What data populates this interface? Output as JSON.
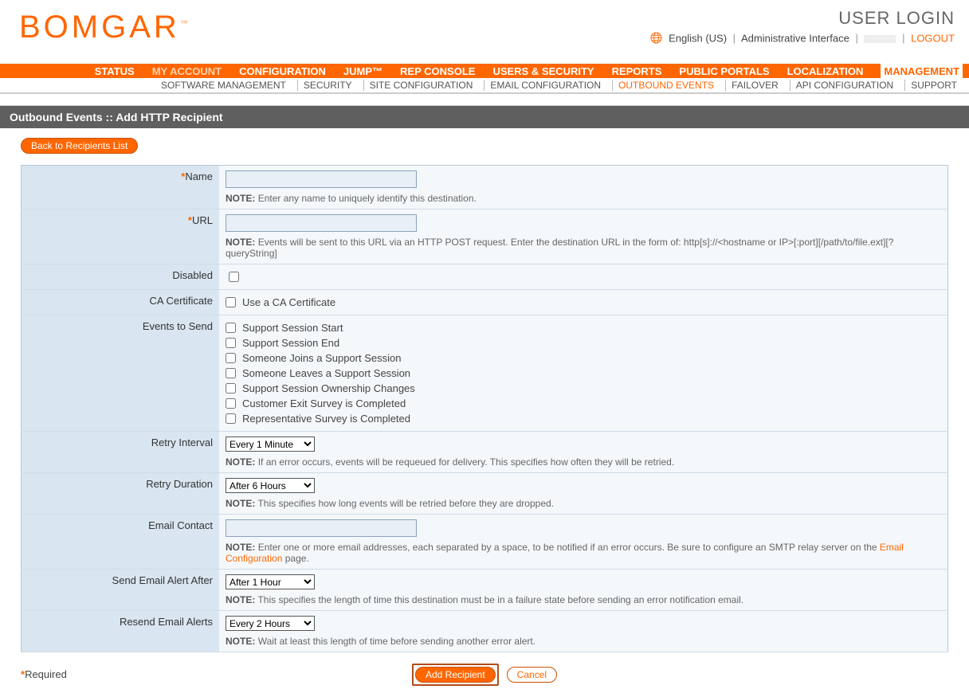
{
  "header": {
    "logo": "BOMGAR",
    "tm": "™",
    "user_login": "USER LOGIN",
    "language": "English (US)",
    "admin_link": "Administrative Interface",
    "logout": "LOGOUT"
  },
  "topnav": [
    {
      "label": "STATUS",
      "style": "normal"
    },
    {
      "label": "MY ACCOUNT",
      "style": "dim"
    },
    {
      "label": "CONFIGURATION",
      "style": "normal"
    },
    {
      "label": "JUMP™",
      "style": "normal"
    },
    {
      "label": "REP CONSOLE",
      "style": "normal"
    },
    {
      "label": "USERS & SECURITY",
      "style": "normal"
    },
    {
      "label": "REPORTS",
      "style": "normal"
    },
    {
      "label": "PUBLIC PORTALS",
      "style": "normal"
    },
    {
      "label": "LOCALIZATION",
      "style": "normal"
    },
    {
      "label": "MANAGEMENT",
      "style": "inv"
    }
  ],
  "subnav": [
    {
      "label": "SOFTWARE MANAGEMENT",
      "active": false
    },
    {
      "label": "SECURITY",
      "active": false
    },
    {
      "label": "SITE CONFIGURATION",
      "active": false
    },
    {
      "label": "EMAIL CONFIGURATION",
      "active": false
    },
    {
      "label": "OUTBOUND EVENTS",
      "active": true
    },
    {
      "label": "FAILOVER",
      "active": false
    },
    {
      "label": "API CONFIGURATION",
      "active": false
    },
    {
      "label": "SUPPORT",
      "active": false
    }
  ],
  "section_title": "Outbound Events :: Add HTTP Recipient",
  "back_btn": "Back to Recipients List",
  "fields": {
    "name": {
      "label": "Name",
      "required": true,
      "note_prefix": "NOTE:",
      "note": "Enter any name to uniquely identify this destination."
    },
    "url": {
      "label": "URL",
      "required": true,
      "note_prefix": "NOTE:",
      "note": "Events will be sent to this URL via an HTTP POST request. Enter the destination URL in the form of: http[s]://<hostname or IP>[:port][/path/to/file.ext][?queryString]"
    },
    "disabled": {
      "label": "Disabled"
    },
    "ca_cert": {
      "label": "CA Certificate",
      "option": "Use a CA Certificate"
    },
    "events": {
      "label": "Events to Send",
      "items": [
        "Support Session Start",
        "Support Session End",
        "Someone Joins a Support Session",
        "Someone Leaves a Support Session",
        "Support Session Ownership Changes",
        "Customer Exit Survey is Completed",
        "Representative Survey is Completed"
      ]
    },
    "retry_interval": {
      "label": "Retry Interval",
      "value": "Every 1 Minute",
      "note_prefix": "NOTE:",
      "note": "If an error occurs, events will be requeued for delivery. This specifies how often they will be retried."
    },
    "retry_duration": {
      "label": "Retry Duration",
      "value": "After 6 Hours",
      "note_prefix": "NOTE:",
      "note": "This specifies how long events will be retried before they are dropped."
    },
    "email_contact": {
      "label": "Email Contact",
      "note_prefix": "NOTE:",
      "note_a": "Enter one or more email addresses, each separated by a space, to be notified if an error occurs. Be sure to configure an SMTP relay server on the ",
      "link": "Email Configuration",
      "note_b": " page."
    },
    "send_after": {
      "label": "Send Email Alert After",
      "value": "After 1 Hour",
      "note_prefix": "NOTE:",
      "note": "This specifies the length of time this destination must be in a failure state before sending an error notification email."
    },
    "resend": {
      "label": "Resend Email Alerts",
      "value": "Every 2 Hours",
      "note_prefix": "NOTE:",
      "note": "Wait at least this length of time before sending another error alert."
    }
  },
  "footer": {
    "required": "Required",
    "add": "Add Recipient",
    "cancel": "Cancel"
  }
}
